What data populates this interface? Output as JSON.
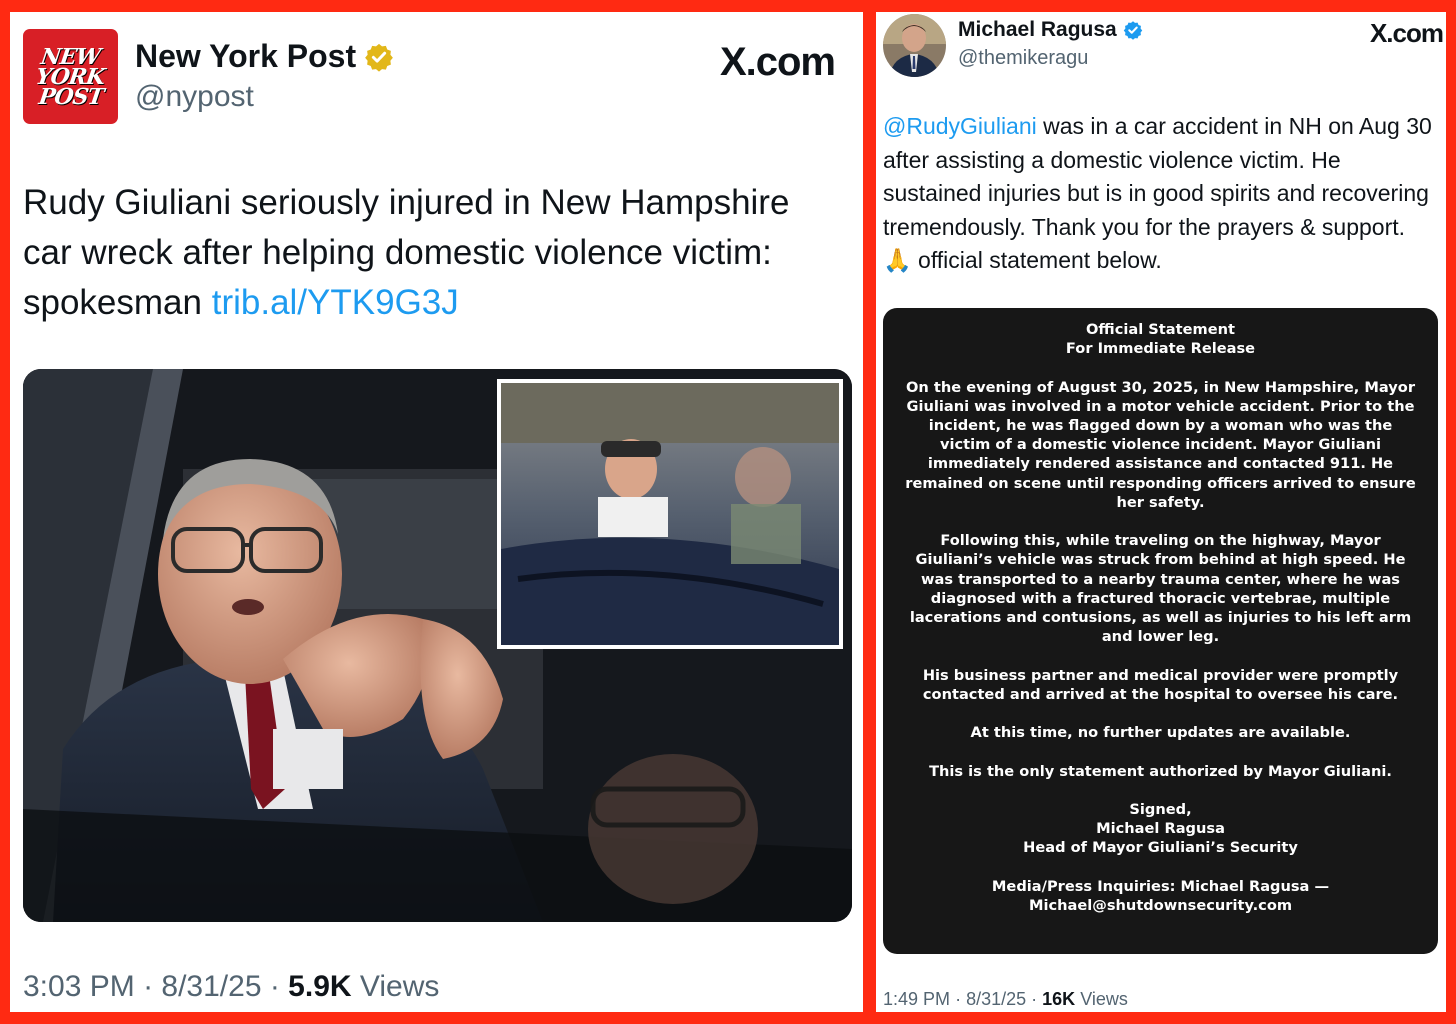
{
  "left_tweet": {
    "author_name": "New York Post",
    "author_handle": "@nypost",
    "avatar_lines": [
      "NEW",
      "YORK",
      "POST"
    ],
    "site": "X.com",
    "text_main": "Rudy Giuliani seriously injured in New Hampshire car wreck after helping domestic violence victim: spokesman ",
    "text_link": "trib.al/YTK9G3J",
    "time": "3:03 PM",
    "date": "8/31/25",
    "views_count": "5.9K",
    "views_label": "Views"
  },
  "right_tweet": {
    "author_name": "Michael Ragusa",
    "author_handle": "@themikeragu",
    "site": "X.com",
    "mention": "@RudyGiuliani",
    "text_main": " was in a car accident in NH on Aug 30 after assisting a domestic violence victim. He sustained injuries but is in good spirits and recovering tremendously. Thank you for the prayers & support. 🙏 official statement below.",
    "statement": {
      "title_line1": "Official Statement",
      "title_line2": "For Immediate Release",
      "paragraph1": "On the evening of August 30, 2025, in New Hampshire, Mayor Giuliani was involved in a motor vehicle accident. Prior to the incident, he was flagged down by a woman who was the victim of a domestic violence incident. Mayor Giuliani immediately rendered assistance and contacted 911. He remained on scene until responding officers arrived to ensure her safety.",
      "paragraph2": "Following this, while traveling on the highway, Mayor Giuliani’s vehicle was struck from behind at high speed. He was transported to a nearby trauma center, where he was diagnosed with a fractured thoracic vertebrae, multiple lacerations and contusions, as well as injuries to his left arm and lower leg.",
      "paragraph3": "His business partner and medical provider were promptly contacted and arrived at the hospital to oversee his care.",
      "paragraph4": "At this time, no further updates are available.",
      "paragraph5": "This is the only statement authorized by Mayor Giuliani.",
      "signed_label": "Signed,",
      "signer_name": "Michael Ragusa",
      "signer_title": "Head of Mayor Giuliani’s Security",
      "press_line1": "Media/Press Inquiries: Michael Ragusa —",
      "press_line2": "Michael@shutdownsecurity.com"
    },
    "time": "1:49 PM",
    "date": "8/31/25",
    "views_count": "16K",
    "views_label": "Views"
  },
  "colors": {
    "frame": "#ff2a12",
    "link": "#1d9bf0",
    "nyp_red": "#d81f26",
    "verified_gold": "#e2b719",
    "verified_blue": "#1d9bf0",
    "statement_bg": "#171717"
  },
  "icons": {
    "left_verified": "verified-gold-badge-icon",
    "right_verified": "verified-blue-badge-icon"
  }
}
